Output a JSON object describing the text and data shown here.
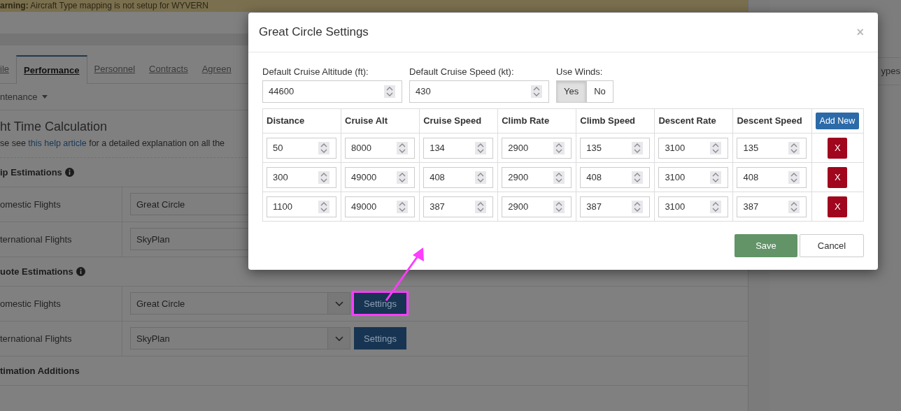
{
  "warning": {
    "label": "arning:",
    "text": "Aircraft Type mapping is not setup for WYVERN"
  },
  "tabs": [
    {
      "label": "ile",
      "selected": false
    },
    {
      "label": "Performance",
      "selected": true
    },
    {
      "label": "Personnel",
      "selected": false
    },
    {
      "label": "Contracts",
      "selected": false
    },
    {
      "label": "Agreen",
      "selected": false
    }
  ],
  "submenu": "ntenance",
  "heading": "ht Time Calculation",
  "help": {
    "before": "se see ",
    "link": "this help article",
    "after": " for a detailed explanation on all the"
  },
  "sections": [
    {
      "title": "ip Estimations",
      "info": true,
      "rows": [
        {
          "label": "omestic Flights",
          "value": "Great Circle"
        },
        {
          "label": "ternational Flights",
          "value": "SkyPlan"
        }
      ]
    },
    {
      "title": "uote Estimations",
      "info": true,
      "rows": [
        {
          "label": "omestic Flights",
          "value": "Great Circle",
          "button": "Settings",
          "highlighted": true
        },
        {
          "label": "ternational Flights",
          "value": "SkyPlan",
          "button": "Settings",
          "highlighted": false
        }
      ]
    },
    {
      "title": "timation Additions",
      "info": false
    }
  ],
  "side_panel": {
    "text": "ypes"
  },
  "modal": {
    "title": "Great Circle Settings",
    "close": "×",
    "fields": [
      {
        "label": "Default Cruise Altitude (ft):",
        "value": "44600"
      },
      {
        "label": "Default Cruise Speed (kt):",
        "value": "430"
      }
    ],
    "use_winds": {
      "label": "Use Winds:",
      "options": [
        {
          "label": "Yes",
          "selected": true
        },
        {
          "label": "No",
          "selected": false
        }
      ]
    },
    "columns": [
      "Distance",
      "Cruise Alt",
      "Cruise Speed",
      "Climb Rate",
      "Climb Speed",
      "Descent Rate",
      "Descent Speed"
    ],
    "add_button": "Add New",
    "rows": [
      {
        "cells": [
          "50",
          "8000",
          "134",
          "2900",
          "135",
          "3100",
          "135"
        ],
        "delete": "X"
      },
      {
        "cells": [
          "300",
          "49000",
          "408",
          "2900",
          "408",
          "3100",
          "408"
        ],
        "delete": "X"
      },
      {
        "cells": [
          "1100",
          "49000",
          "387",
          "2900",
          "387",
          "3100",
          "387"
        ],
        "delete": "X"
      }
    ],
    "save": "Save",
    "cancel": "Cancel"
  }
}
